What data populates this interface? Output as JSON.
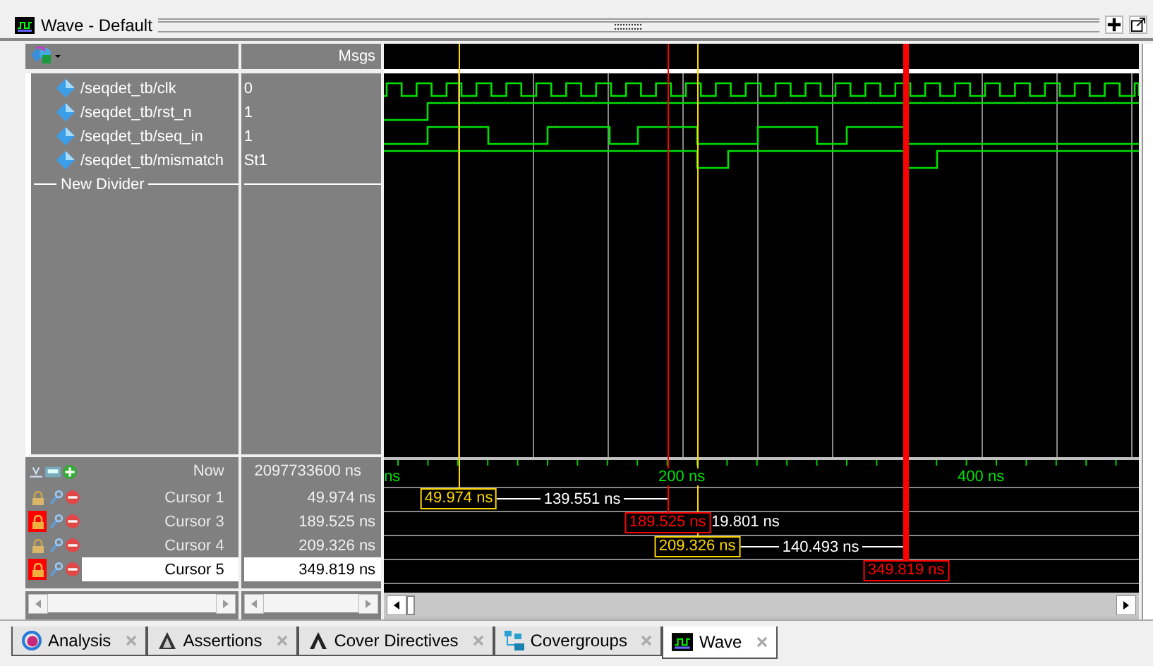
{
  "window": {
    "title": "Wave - Default"
  },
  "header": {
    "values_label": "Msgs"
  },
  "signals": [
    {
      "name": "/seqdet_tb/clk",
      "value": "0"
    },
    {
      "name": "/seqdet_tb/rst_n",
      "value": "1"
    },
    {
      "name": "/seqdet_tb/seq_in",
      "value": "1"
    },
    {
      "name": "/seqdet_tb/mismatch",
      "value": "St1"
    }
  ],
  "divider": {
    "label": "New Divider"
  },
  "now": {
    "label": "Now",
    "value": "2097733600 ns"
  },
  "timeline": {
    "ticks": [
      "ns",
      "200 ns",
      "400 ns"
    ]
  },
  "cursors": [
    {
      "name": "Cursor 1",
      "time": "49.974 ns",
      "wave_label": "49.974 ns",
      "locked": false,
      "selected": false,
      "delta": "139.551 ns"
    },
    {
      "name": "Cursor 3",
      "time": "189.525 ns",
      "wave_label": "189.525 ns",
      "locked": true,
      "selected": false,
      "delta": "19.801 ns"
    },
    {
      "name": "Cursor 4",
      "time": "209.326 ns",
      "wave_label": "209.326 ns",
      "locked": false,
      "selected": false,
      "delta": "140.493 ns"
    },
    {
      "name": "Cursor 5",
      "time": "349.819 ns",
      "wave_label": "349.819 ns",
      "locked": true,
      "selected": true
    }
  ],
  "tabs": [
    {
      "label": "Analysis",
      "selected": false
    },
    {
      "label": "Assertions",
      "selected": false
    },
    {
      "label": "Cover Directives",
      "selected": false
    },
    {
      "label": "Covergroups",
      "selected": false
    },
    {
      "label": "Wave",
      "selected": true
    }
  ]
}
